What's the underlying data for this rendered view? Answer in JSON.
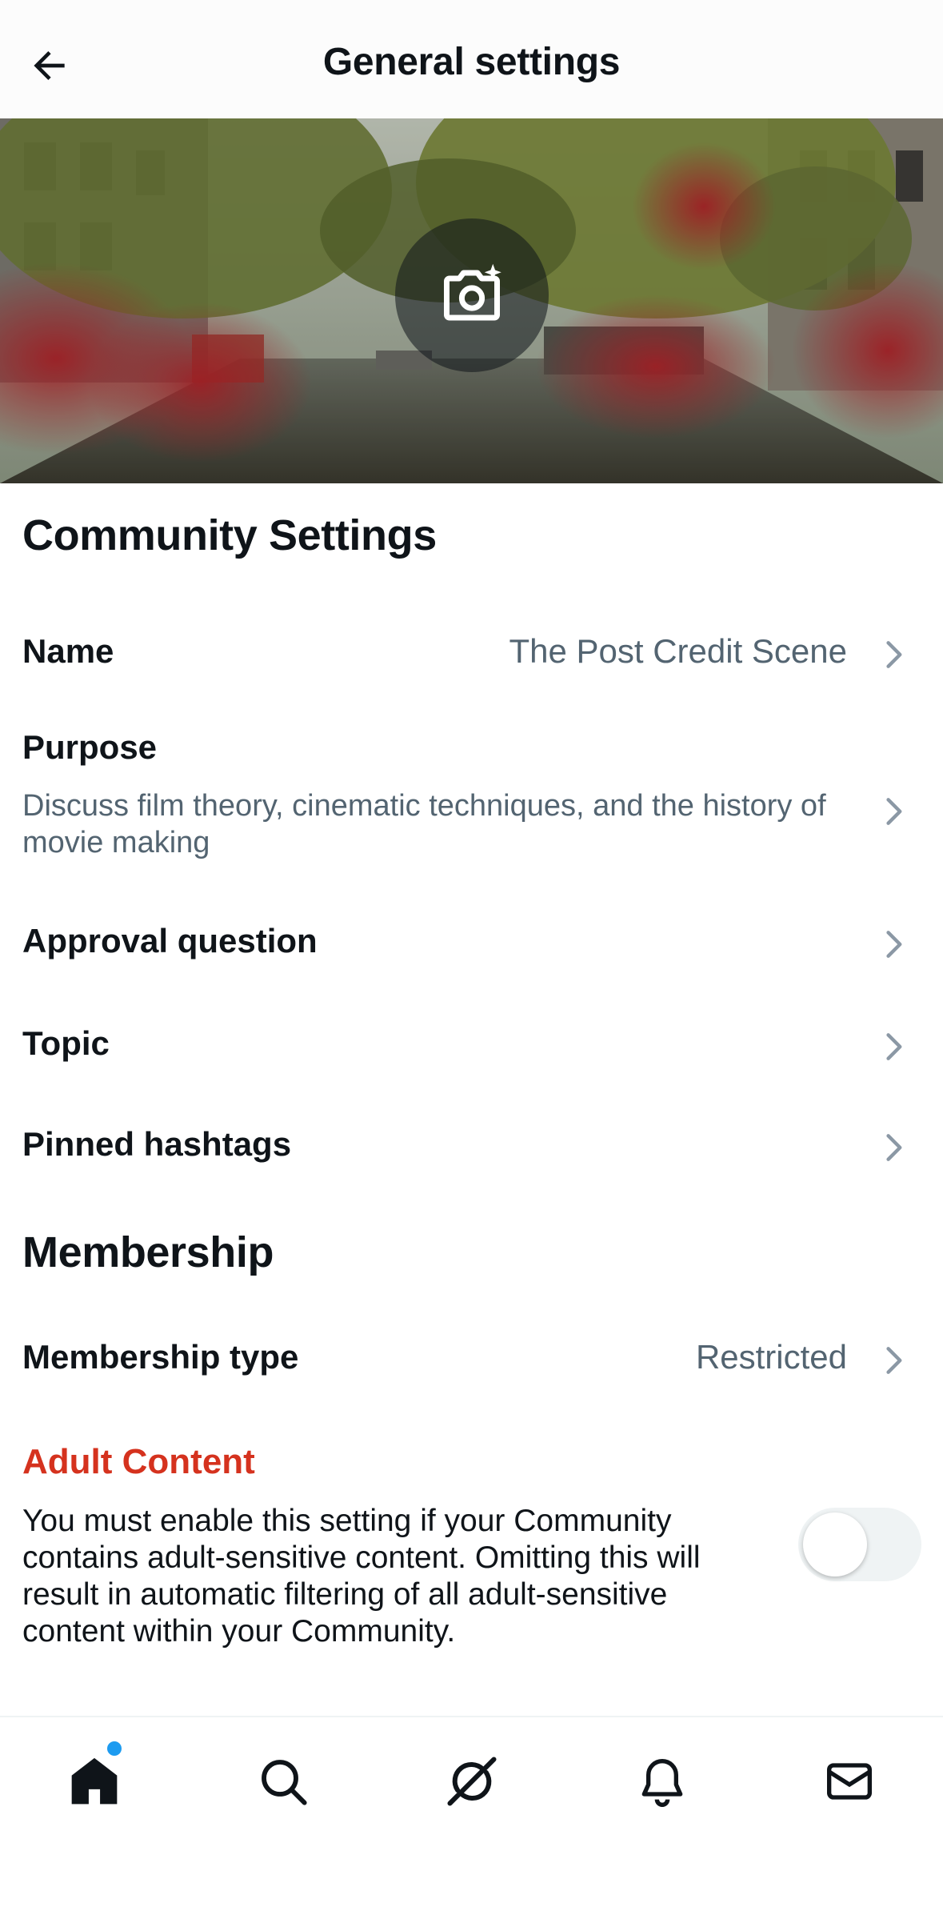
{
  "header": {
    "title": "General settings",
    "back_icon": "back-arrow-icon"
  },
  "banner": {
    "camera_icon": "camera-plus-icon"
  },
  "community_settings": {
    "title": "Community Settings",
    "name": {
      "label": "Name",
      "value": "The Post Credit Scene"
    },
    "purpose": {
      "label": "Purpose",
      "value": "Discuss film theory, cinematic techniques, and the history of movie making"
    },
    "approval_question": {
      "label": "Approval question"
    },
    "topic": {
      "label": "Topic"
    },
    "pinned_hashtags": {
      "label": "Pinned hashtags"
    }
  },
  "membership": {
    "title": "Membership",
    "type": {
      "label": "Membership type",
      "value": "Restricted"
    }
  },
  "adult_content": {
    "title": "Adult Content",
    "description": "You must enable this setting if your Community contains adult-sensitive content. Omitting this will result in automatic filtering of all adult-sensitive content within your Community.",
    "enabled": false
  },
  "tabbar": {
    "items": [
      "home-icon",
      "search-icon",
      "grok-icon",
      "bell-icon",
      "mail-icon"
    ],
    "home_has_notification": true
  },
  "colors": {
    "accent": "#1d9bf0",
    "warning": "#d5321e",
    "secondary_text": "#536471",
    "toggle_off": "#eff3f4"
  }
}
